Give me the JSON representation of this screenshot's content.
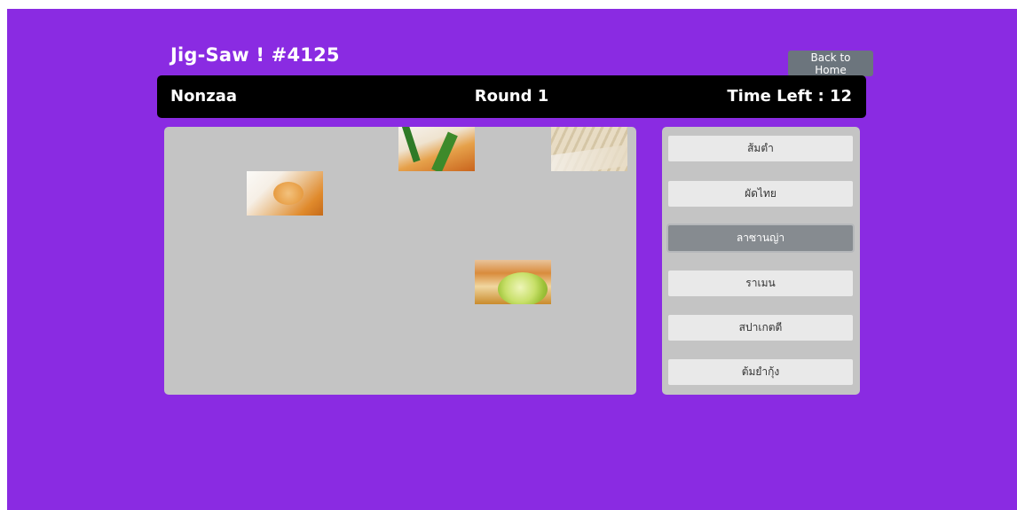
{
  "header": {
    "title": "Jig-Saw ! #4125",
    "back_button": "Back to Home"
  },
  "status": {
    "player": "Nonzaa",
    "round": "Round 1",
    "time_label": "Time Left",
    "time_value": "12"
  },
  "choices": [
    {
      "label": "ส้มตำ",
      "selected": false
    },
    {
      "label": "ผัดไทย",
      "selected": false
    },
    {
      "label": "ลาซานญ่า",
      "selected": true
    },
    {
      "label": "ราเมน",
      "selected": false
    },
    {
      "label": "สปาเกตตี",
      "selected": false
    },
    {
      "label": "ต้มยำกุ้ง",
      "selected": false
    }
  ],
  "colors": {
    "background": "#8a2be2",
    "status_bar": "#000000",
    "panel": "#c4c4c4",
    "choice_button": "#e9e9e9",
    "choice_selected": "#868b90",
    "back_button": "#6c757d"
  },
  "board": {
    "revealed_pieces": 4
  }
}
